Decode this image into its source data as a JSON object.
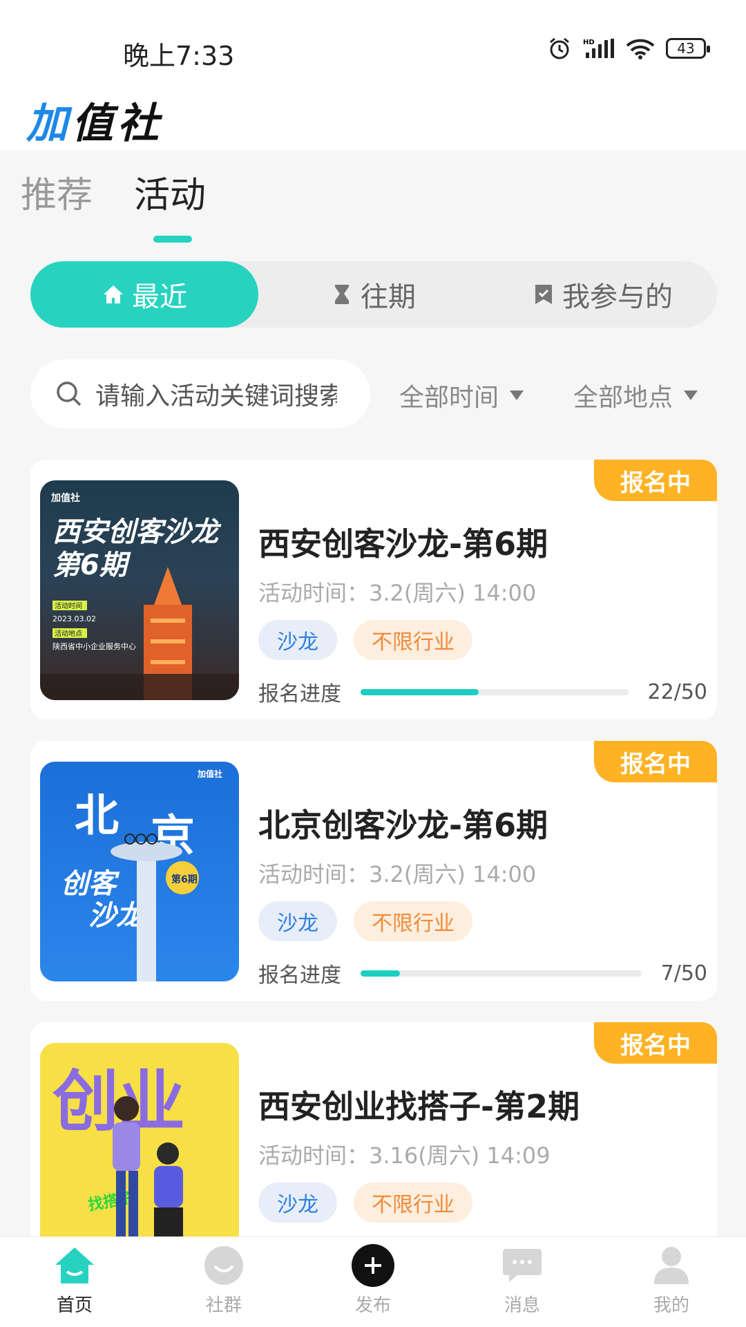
{
  "status": {
    "time": "晚上7:33",
    "battery": "43"
  },
  "app": {
    "logo_text": "值社",
    "logo_prefix": "加"
  },
  "top_tabs": [
    {
      "label": "推荐"
    },
    {
      "label": "活动"
    }
  ],
  "segments": [
    {
      "label": "最近",
      "icon": "home-icon"
    },
    {
      "label": "往期",
      "icon": "hourglass-icon"
    },
    {
      "label": "我参与的",
      "icon": "bookmark-check-icon"
    }
  ],
  "search": {
    "placeholder": "请输入活动关键词搜索"
  },
  "filters": {
    "time": "全部时间",
    "location": "全部地点"
  },
  "labels": {
    "time_prefix": "活动时间：",
    "progress": "报名进度"
  },
  "events": [
    {
      "status": "报名中",
      "title": "西安创客沙龙-第6期",
      "time": "3.2(周六) 14:00",
      "tags": [
        "沙龙",
        "不限行业"
      ],
      "registered": 22,
      "capacity": 50,
      "count_text": "22/50",
      "poster": {
        "brand": "加值社",
        "headline1": "西安创客沙龙",
        "headline2": "第6期",
        "label_time": "活动时间",
        "date": "2023.03.02",
        "label_place": "活动地点",
        "place": "陕西省中小企业服务中心"
      }
    },
    {
      "status": "报名中",
      "title": "北京创客沙龙-第6期",
      "time": "3.2(周六) 14:00",
      "tags": [
        "沙龙",
        "不限行业"
      ],
      "registered": 7,
      "capacity": 50,
      "count_text": "7/50",
      "poster": {
        "brand": "加值社",
        "big1": "北",
        "big2": "京",
        "sub1": "创客",
        "sub2": "沙龙",
        "issue": "第6期"
      }
    },
    {
      "status": "报名中",
      "title": "西安创业找搭子-第2期",
      "time": "3.16(周六) 14:09",
      "tags": [
        "沙龙",
        "不限行业"
      ],
      "poster": {
        "big": "创业",
        "ring": "找搭子"
      }
    }
  ],
  "bottom_nav": [
    {
      "label": "首页",
      "icon": "home-icon"
    },
    {
      "label": "社群",
      "icon": "community-icon"
    },
    {
      "label": "发布",
      "icon": "plus-icon"
    },
    {
      "label": "消息",
      "icon": "message-icon"
    },
    {
      "label": "我的",
      "icon": "user-icon"
    }
  ],
  "colors": {
    "accent": "#27d3c0",
    "badge": "#ffb224",
    "tag_blue": "#2f7fe0",
    "tag_orange": "#f08a3a"
  }
}
